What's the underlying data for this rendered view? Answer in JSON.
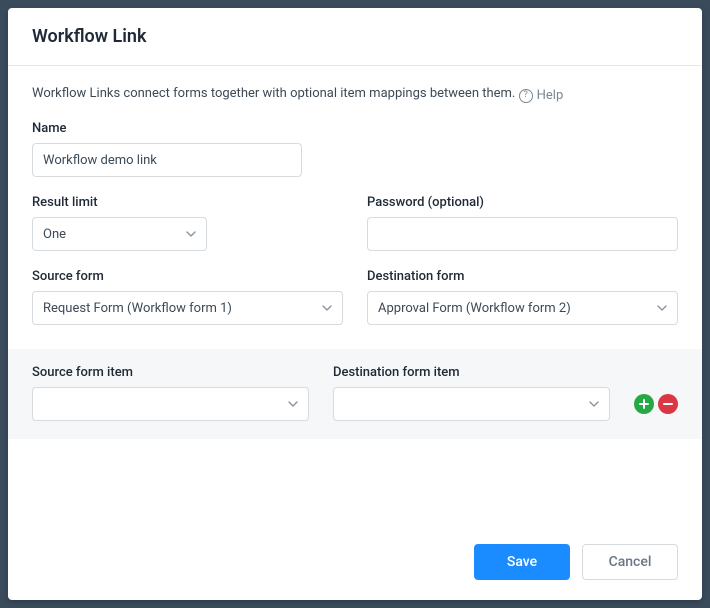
{
  "dialog": {
    "title": "Workflow Link",
    "description": "Workflow Links connect forms together with optional item mappings between them.",
    "help_label": "Help"
  },
  "fields": {
    "name": {
      "label": "Name",
      "value": "Workflow demo link"
    },
    "result_limit": {
      "label": "Result limit",
      "value": "One"
    },
    "password": {
      "label": "Password (optional)",
      "value": ""
    },
    "source_form": {
      "label": "Source form",
      "value": "Request Form (Workflow form 1)"
    },
    "destination_form": {
      "label": "Destination form",
      "value": "Approval Form (Workflow form 2)"
    },
    "source_form_item": {
      "label": "Source form item",
      "value": ""
    },
    "destination_form_item": {
      "label": "Destination form item",
      "value": ""
    }
  },
  "footer": {
    "save": "Save",
    "cancel": "Cancel"
  }
}
